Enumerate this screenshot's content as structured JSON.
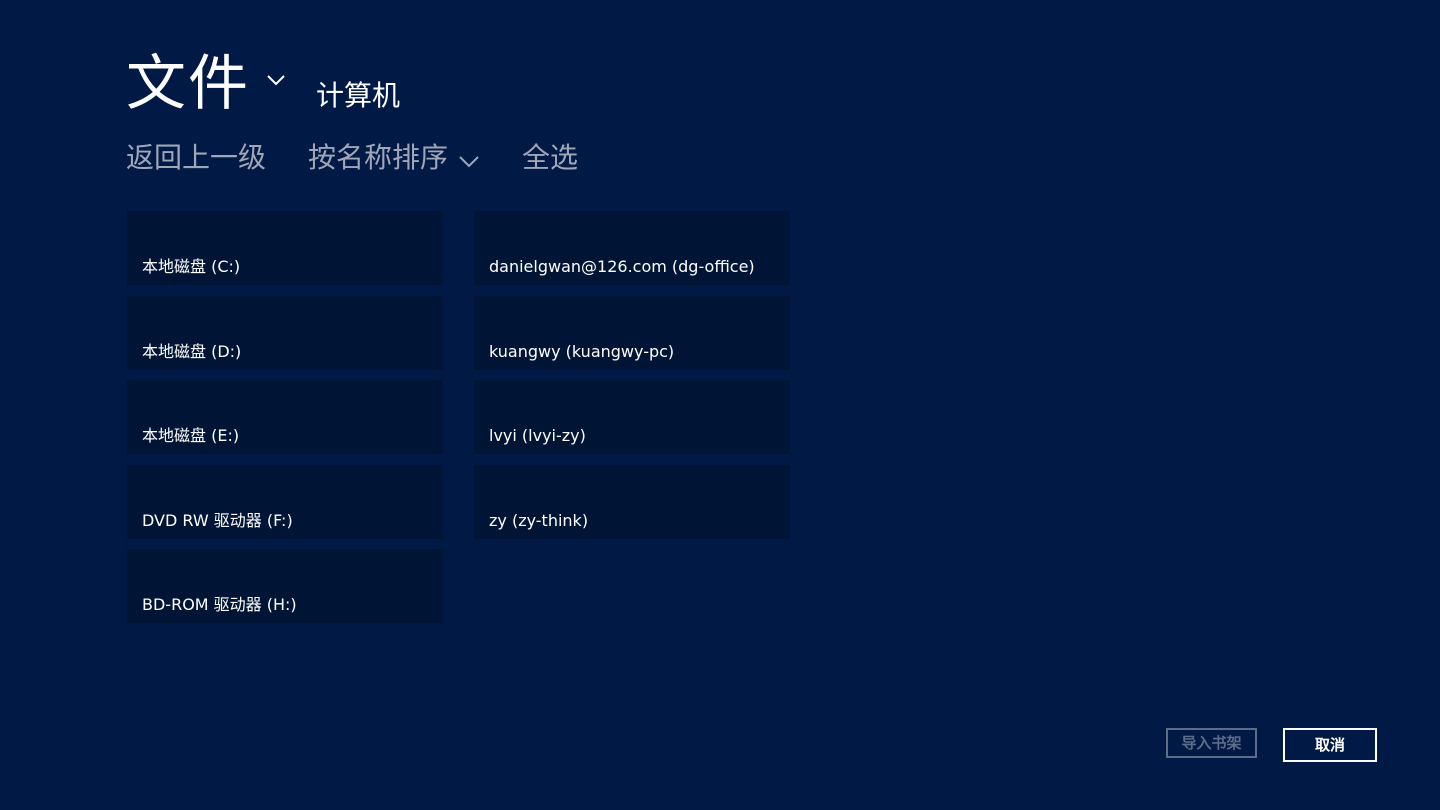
{
  "header": {
    "title": "文件",
    "title_dropdown_icon": "chevron-down-icon",
    "location": "计算机"
  },
  "commands": {
    "back": "返回上一级",
    "sort": "按名称排序",
    "sort_dropdown_icon": "chevron-down-icon",
    "select_all": "全选"
  },
  "items": [
    {
      "label": "本地磁盘 (C:)"
    },
    {
      "label": "本地磁盘 (D:)"
    },
    {
      "label": "本地磁盘 (E:)"
    },
    {
      "label": "DVD RW 驱动器 (F:)"
    },
    {
      "label": "BD-ROM 驱动器 (H:)"
    },
    {
      "label": "danielgwan@126.com (dg-office)"
    },
    {
      "label": "kuangwy (kuangwy-pc)"
    },
    {
      "label": "lvyi (lvyi-zy)"
    },
    {
      "label": "zy (zy-think)"
    }
  ],
  "footer": {
    "import_label": "导入书架",
    "cancel_label": "取消"
  },
  "colors": {
    "background": "#001a45",
    "tile": "#001535",
    "command_text": "#9ea6b7",
    "disabled": "#5d6c87"
  }
}
